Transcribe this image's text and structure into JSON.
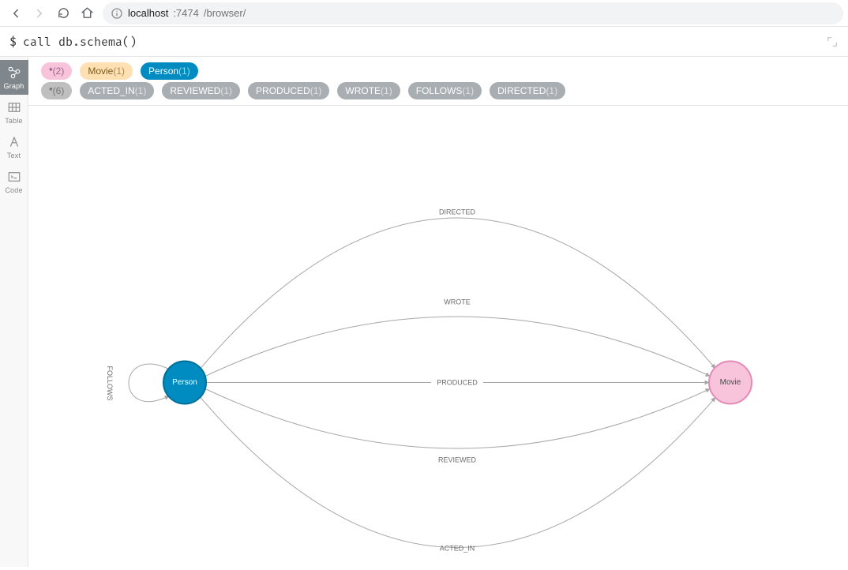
{
  "browser": {
    "url_host": "localhost",
    "url_port": ":7474",
    "url_path": "/browser/"
  },
  "command": {
    "prompt": "$",
    "query": "call db.schema()"
  },
  "sidebar": {
    "items": [
      {
        "label": "Graph"
      },
      {
        "label": "Table"
      },
      {
        "label": "Text"
      },
      {
        "label": "Code"
      }
    ]
  },
  "node_pills": [
    {
      "label": "*",
      "count": "(2)",
      "cls": "pill-star"
    },
    {
      "label": "Movie",
      "count": "(1)",
      "cls": "pill-movie"
    },
    {
      "label": "Person",
      "count": "(1)",
      "cls": "pill-person"
    }
  ],
  "rel_pills": [
    {
      "label": "*",
      "count": "(6)",
      "cls": "pill-rel-star"
    },
    {
      "label": "ACTED_IN",
      "count": "(1)",
      "cls": "pill-rel"
    },
    {
      "label": "REVIEWED",
      "count": "(1)",
      "cls": "pill-rel"
    },
    {
      "label": "PRODUCED",
      "count": "(1)",
      "cls": "pill-rel"
    },
    {
      "label": "WROTE",
      "count": "(1)",
      "cls": "pill-rel"
    },
    {
      "label": "FOLLOWS",
      "count": "(1)",
      "cls": "pill-rel"
    },
    {
      "label": "DIRECTED",
      "count": "(1)",
      "cls": "pill-rel"
    }
  ],
  "graph": {
    "nodes": {
      "person": {
        "label": "Person"
      },
      "movie": {
        "label": "Movie"
      }
    },
    "edges": {
      "directed": "DIRECTED",
      "wrote": "WROTE",
      "produced": "PRODUCED",
      "reviewed": "REVIEWED",
      "acted_in": "ACTED_IN",
      "follows": "FOLLOWS"
    }
  }
}
